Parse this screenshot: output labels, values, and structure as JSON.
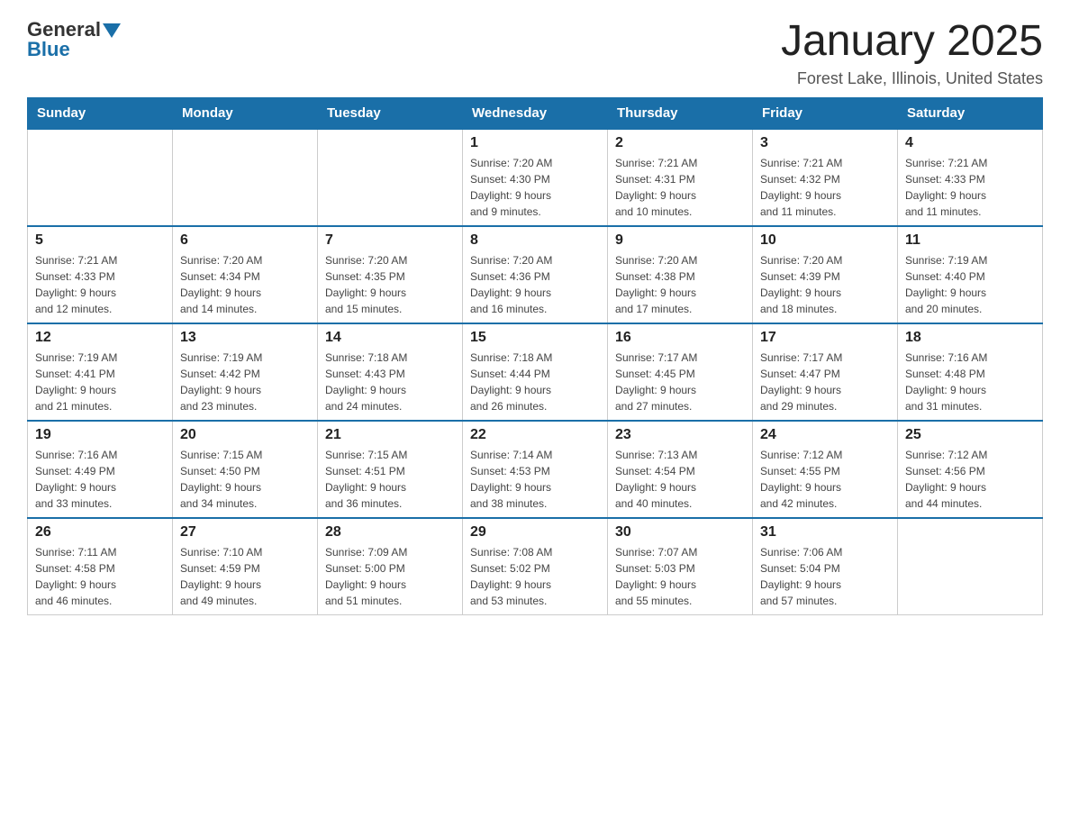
{
  "header": {
    "logo_text1": "General",
    "logo_text2": "Blue",
    "month_title": "January 2025",
    "location": "Forest Lake, Illinois, United States"
  },
  "days_of_week": [
    "Sunday",
    "Monday",
    "Tuesday",
    "Wednesday",
    "Thursday",
    "Friday",
    "Saturday"
  ],
  "weeks": [
    [
      {
        "day": "",
        "info": ""
      },
      {
        "day": "",
        "info": ""
      },
      {
        "day": "",
        "info": ""
      },
      {
        "day": "1",
        "info": "Sunrise: 7:20 AM\nSunset: 4:30 PM\nDaylight: 9 hours\nand 9 minutes."
      },
      {
        "day": "2",
        "info": "Sunrise: 7:21 AM\nSunset: 4:31 PM\nDaylight: 9 hours\nand 10 minutes."
      },
      {
        "day": "3",
        "info": "Sunrise: 7:21 AM\nSunset: 4:32 PM\nDaylight: 9 hours\nand 11 minutes."
      },
      {
        "day": "4",
        "info": "Sunrise: 7:21 AM\nSunset: 4:33 PM\nDaylight: 9 hours\nand 11 minutes."
      }
    ],
    [
      {
        "day": "5",
        "info": "Sunrise: 7:21 AM\nSunset: 4:33 PM\nDaylight: 9 hours\nand 12 minutes."
      },
      {
        "day": "6",
        "info": "Sunrise: 7:20 AM\nSunset: 4:34 PM\nDaylight: 9 hours\nand 14 minutes."
      },
      {
        "day": "7",
        "info": "Sunrise: 7:20 AM\nSunset: 4:35 PM\nDaylight: 9 hours\nand 15 minutes."
      },
      {
        "day": "8",
        "info": "Sunrise: 7:20 AM\nSunset: 4:36 PM\nDaylight: 9 hours\nand 16 minutes."
      },
      {
        "day": "9",
        "info": "Sunrise: 7:20 AM\nSunset: 4:38 PM\nDaylight: 9 hours\nand 17 minutes."
      },
      {
        "day": "10",
        "info": "Sunrise: 7:20 AM\nSunset: 4:39 PM\nDaylight: 9 hours\nand 18 minutes."
      },
      {
        "day": "11",
        "info": "Sunrise: 7:19 AM\nSunset: 4:40 PM\nDaylight: 9 hours\nand 20 minutes."
      }
    ],
    [
      {
        "day": "12",
        "info": "Sunrise: 7:19 AM\nSunset: 4:41 PM\nDaylight: 9 hours\nand 21 minutes."
      },
      {
        "day": "13",
        "info": "Sunrise: 7:19 AM\nSunset: 4:42 PM\nDaylight: 9 hours\nand 23 minutes."
      },
      {
        "day": "14",
        "info": "Sunrise: 7:18 AM\nSunset: 4:43 PM\nDaylight: 9 hours\nand 24 minutes."
      },
      {
        "day": "15",
        "info": "Sunrise: 7:18 AM\nSunset: 4:44 PM\nDaylight: 9 hours\nand 26 minutes."
      },
      {
        "day": "16",
        "info": "Sunrise: 7:17 AM\nSunset: 4:45 PM\nDaylight: 9 hours\nand 27 minutes."
      },
      {
        "day": "17",
        "info": "Sunrise: 7:17 AM\nSunset: 4:47 PM\nDaylight: 9 hours\nand 29 minutes."
      },
      {
        "day": "18",
        "info": "Sunrise: 7:16 AM\nSunset: 4:48 PM\nDaylight: 9 hours\nand 31 minutes."
      }
    ],
    [
      {
        "day": "19",
        "info": "Sunrise: 7:16 AM\nSunset: 4:49 PM\nDaylight: 9 hours\nand 33 minutes."
      },
      {
        "day": "20",
        "info": "Sunrise: 7:15 AM\nSunset: 4:50 PM\nDaylight: 9 hours\nand 34 minutes."
      },
      {
        "day": "21",
        "info": "Sunrise: 7:15 AM\nSunset: 4:51 PM\nDaylight: 9 hours\nand 36 minutes."
      },
      {
        "day": "22",
        "info": "Sunrise: 7:14 AM\nSunset: 4:53 PM\nDaylight: 9 hours\nand 38 minutes."
      },
      {
        "day": "23",
        "info": "Sunrise: 7:13 AM\nSunset: 4:54 PM\nDaylight: 9 hours\nand 40 minutes."
      },
      {
        "day": "24",
        "info": "Sunrise: 7:12 AM\nSunset: 4:55 PM\nDaylight: 9 hours\nand 42 minutes."
      },
      {
        "day": "25",
        "info": "Sunrise: 7:12 AM\nSunset: 4:56 PM\nDaylight: 9 hours\nand 44 minutes."
      }
    ],
    [
      {
        "day": "26",
        "info": "Sunrise: 7:11 AM\nSunset: 4:58 PM\nDaylight: 9 hours\nand 46 minutes."
      },
      {
        "day": "27",
        "info": "Sunrise: 7:10 AM\nSunset: 4:59 PM\nDaylight: 9 hours\nand 49 minutes."
      },
      {
        "day": "28",
        "info": "Sunrise: 7:09 AM\nSunset: 5:00 PM\nDaylight: 9 hours\nand 51 minutes."
      },
      {
        "day": "29",
        "info": "Sunrise: 7:08 AM\nSunset: 5:02 PM\nDaylight: 9 hours\nand 53 minutes."
      },
      {
        "day": "30",
        "info": "Sunrise: 7:07 AM\nSunset: 5:03 PM\nDaylight: 9 hours\nand 55 minutes."
      },
      {
        "day": "31",
        "info": "Sunrise: 7:06 AM\nSunset: 5:04 PM\nDaylight: 9 hours\nand 57 minutes."
      },
      {
        "day": "",
        "info": ""
      }
    ]
  ]
}
